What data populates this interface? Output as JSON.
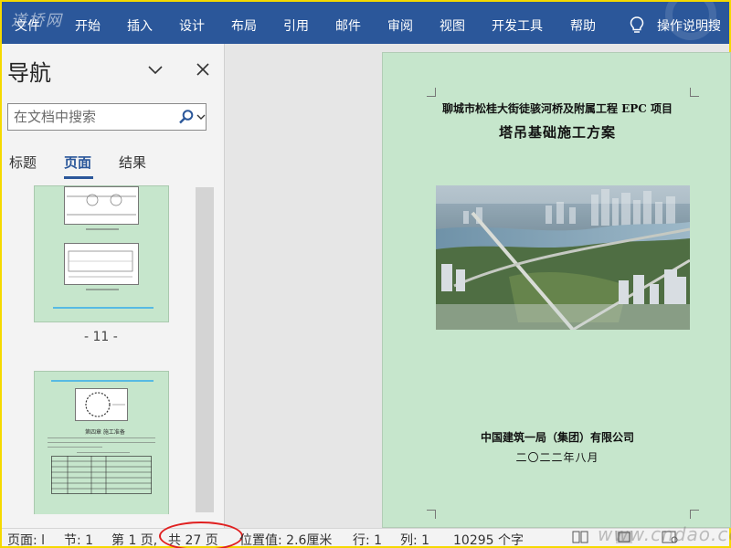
{
  "ribbon": {
    "watermark": "道桥网",
    "tabs": [
      "文件",
      "开始",
      "插入",
      "设计",
      "布局",
      "引用",
      "邮件",
      "审阅",
      "视图",
      "开发工具",
      "帮助"
    ],
    "tell_me": "操作说明搜"
  },
  "nav": {
    "title": "导航",
    "search_placeholder": "在文档中搜索",
    "tabs": [
      "标题",
      "页面",
      "结果"
    ],
    "active_tab": "页面",
    "thumbnails": [
      {
        "page_label": "- 11 -"
      },
      {
        "page_label": "第四章  施工准备"
      }
    ]
  },
  "document": {
    "project_title": "聊城市松桂大街徒骇河桥及附属工程 EPC 项目",
    "doc_title": "塔吊基础施工方案",
    "company": "中国建筑一局（集团）有限公司",
    "date": "二〇二二年八月"
  },
  "status": {
    "page": "页面: l",
    "section": "节: 1",
    "page_of": "第 1 页,",
    "total": "共 27 页",
    "position": "位置值: 2.6厘米",
    "line": "行: 1",
    "column": "列: 1",
    "words": "10295 个字",
    "watermark": "www.cndao.com"
  },
  "colors": {
    "ribbon": "#2b579a",
    "page_bg": "#c6e6cc",
    "highlight": "#e02020"
  }
}
